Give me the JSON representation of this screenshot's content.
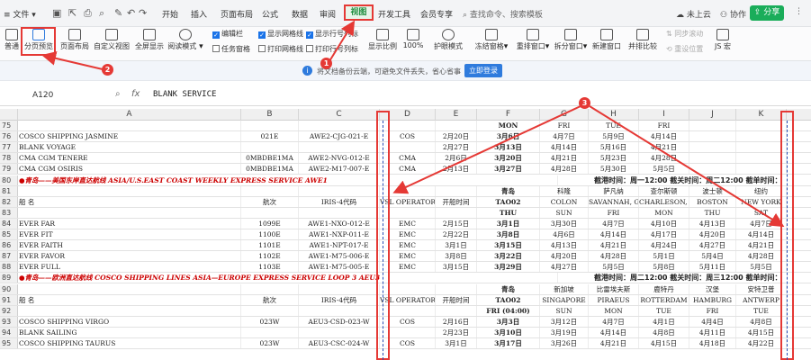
{
  "menubar": {
    "file": "文件",
    "tabs": [
      "开始",
      "插入",
      "页面布局",
      "公式",
      "数据",
      "审阅"
    ],
    "view_tab": "视图",
    "tabs_after": [
      "开发工具",
      "会员专享"
    ],
    "search": "查找命令、搜索模板",
    "cloud": "未上云",
    "collab": "协作",
    "share": "分享"
  },
  "ribbon": {
    "normal": "普通",
    "page_break": "分页预览",
    "page_layout": "页面布局",
    "custom_view": "自定义视图",
    "fullscreen": "全屏显示",
    "reading": "阅读模式",
    "chk_editbar": "编辑栏",
    "chk_taskpane": "任务窗格",
    "chk_gridlines": "显示网格线",
    "chk_print_grid": "打印网格线",
    "chk_rowcol": "显示行号列标",
    "chk_print_rowcol": "打印行号列标",
    "zoom": "显示比例",
    "zoom100": "100%",
    "eye": "护眼模式",
    "freeze": "冻结窗格",
    "rearrange": "重排窗口",
    "split": "拆分窗口",
    "new_window": "新建窗口",
    "side_by_side": "并排比较",
    "sync_scroll": "同步滚动",
    "reset_pos": "重设位置",
    "js_macro": "JS 宏"
  },
  "notice": {
    "text": "将文档备份云端，可避免文件丢失，省心省事",
    "button": "立即登录"
  },
  "formula": {
    "cell": "A120",
    "content": "BLANK  SERVICE"
  },
  "columns": [
    "A",
    "B",
    "C",
    "D",
    "E",
    "F",
    "G",
    "H",
    "I",
    "J",
    "K"
  ],
  "rows": [
    {
      "n": "75",
      "a": "",
      "b": "",
      "c": "",
      "d": "",
      "e": "",
      "f": "MON",
      "g": "FRI",
      "h": "TUE",
      "i": "FRI",
      "j": "",
      "k": ""
    },
    {
      "n": "76",
      "a": "COSCO SHIPPING JASMINE",
      "b": "021E",
      "c": "AWE2-CJG-021-E",
      "d": "COS",
      "e": "2月20日",
      "f": "3月6日",
      "g": "4月7日",
      "h": "5月9日",
      "i": "4月14日",
      "j": "",
      "k": ""
    },
    {
      "n": "77",
      "a": "BLANK VOYAGE",
      "b": "",
      "c": "",
      "d": "",
      "e": "2月27日",
      "f": "3月13日",
      "g": "4月14日",
      "h": "5月16日",
      "i": "4月21日",
      "j": "",
      "k": ""
    },
    {
      "n": "78",
      "a": "CMA CGM TENERE",
      "b": "0MBDBE1MA",
      "c": "AWE2-NVG-012-E",
      "d": "CMA",
      "e": "2月6日",
      "f": "3月20日",
      "g": "4月21日",
      "h": "5月23日",
      "i": "4月28日",
      "j": "",
      "k": ""
    },
    {
      "n": "79",
      "a": "CMA CGM OSIRIS",
      "b": "0MBDBE1MA",
      "c": "AWE2-M17-007-E",
      "d": "CMA",
      "e": "2月13日",
      "f": "3月27日",
      "g": "4月28日",
      "h": "5月30日",
      "i": "5月5日",
      "j": "",
      "k": ""
    },
    {
      "n": "80",
      "banner": "●青岛——美国东岸直达航线 ASIA/U.S.EAST COAST WEEKLY EXPRESS SERVICE AWE1",
      "right": "截港时间：周一12:00  截关时间：周二12:00  截单时间："
    },
    {
      "n": "81",
      "a": "",
      "b": "",
      "c": "",
      "d": "",
      "e": "",
      "f": "青岛",
      "g": "科隆",
      "h": "萨凡纳",
      "i": "查尔斯顿",
      "j": "波士顿",
      "k": "纽约"
    },
    {
      "n": "82",
      "a": "船         名",
      "b": "航次",
      "c": "IRIS-4代码",
      "d": "VSL OPERATOR",
      "e": "开船时间",
      "f": "TAO02",
      "g": "COLON",
      "h": "SAVANNAH, GA",
      "i": "CHARLESON, SC",
      "j": "BOSTON",
      "k": "NEW YORK"
    },
    {
      "n": "83",
      "a": "",
      "b": "",
      "c": "",
      "d": "",
      "e": "",
      "f": "THU",
      "g": "SUN",
      "h": "FRI",
      "i": "MON",
      "j": "THU",
      "k": "SAT"
    },
    {
      "n": "84",
      "a": "EVER FAR",
      "b": "1099E",
      "c": "AWE1-NXO-012-E",
      "d": "EMC",
      "e": "2月15日",
      "f": "3月1日",
      "g": "3月30日",
      "h": "4月7日",
      "i": "4月10日",
      "j": "4月13日",
      "k": "4月7日"
    },
    {
      "n": "85",
      "a": "EVER FIT",
      "b": "1100E",
      "c": "AWE1-NXP-011-E",
      "d": "EMC",
      "e": "2月22日",
      "f": "3月8日",
      "g": "4月6日",
      "h": "4月14日",
      "i": "4月17日",
      "j": "4月20日",
      "k": "4月14日"
    },
    {
      "n": "86",
      "a": "EVER FAITH",
      "b": "1101E",
      "c": "AWE1-NPT-017-E",
      "d": "EMC",
      "e": "3月1日",
      "f": "3月15日",
      "g": "4月13日",
      "h": "4月21日",
      "i": "4月24日",
      "j": "4月27日",
      "k": "4月21日"
    },
    {
      "n": "87",
      "a": "EVER FAVOR",
      "b": "1102E",
      "c": "AWE1-M75-006-E",
      "d": "EMC",
      "e": "3月8日",
      "f": "3月22日",
      "g": "4月20日",
      "h": "4月28日",
      "i": "5月1日",
      "j": "5月4日",
      "k": "4月28日"
    },
    {
      "n": "88",
      "a": "EVER FULL",
      "b": "1103E",
      "c": "AWE1-M75-005-E",
      "d": "EMC",
      "e": "3月15日",
      "f": "3月29日",
      "g": "4月27日",
      "h": "5月5日",
      "i": "5月8日",
      "j": "5月11日",
      "k": "5月5日"
    },
    {
      "n": "89",
      "banner": "●青岛——欧洲直达航线 COSCO SHIPPING LINES ASIA—EUROPE EXPRESS SERVICE LOOP 3  AEU3",
      "right": "截港时间：周二12:00  截关时间：周三12:00  截单时间："
    },
    {
      "n": "90",
      "a": "",
      "b": "",
      "c": "",
      "d": "",
      "e": "",
      "f": "青岛",
      "g": "新加坡",
      "h": "比雷埃夫斯",
      "i": "鹿特丹",
      "j": "汉堡",
      "k": "安特卫普"
    },
    {
      "n": "91",
      "a": "船         名",
      "b": "航次",
      "c": "IRIS-4代码",
      "d": "VSL OPERATOR",
      "e": "开船时间",
      "f": "TAO02",
      "g": "SINGAPORE",
      "h": "PIRAEUS",
      "i": "ROTTERDAM",
      "j": "HAMBURG",
      "k": "ANTWERP"
    },
    {
      "n": "92",
      "a": "",
      "b": "",
      "c": "",
      "d": "",
      "e": "",
      "f": "FRI (04:00)",
      "g": "SUN",
      "h": "MON",
      "i": "TUE",
      "j": "FRI",
      "k": "TUE"
    },
    {
      "n": "93",
      "a": "COSCO SHIPPING VIRGO",
      "b": "023W",
      "c": "AEU3-CSD-023-W",
      "d": "COS",
      "e": "2月16日",
      "f": "3月3日",
      "g": "3月12日",
      "h": "4月7日",
      "i": "4月1日",
      "j": "4月4日",
      "k": "4月8日"
    },
    {
      "n": "94",
      "a": "BLANK SAILING",
      "b": "",
      "c": "",
      "d": "",
      "e": "2月23日",
      "f": "3月10日",
      "g": "3月19日",
      "h": "4月14日",
      "i": "4月8日",
      "j": "4月11日",
      "k": "4月15日"
    },
    {
      "n": "95",
      "a": "COSCO SHIPPING TAURUS",
      "b": "023W",
      "c": "AEU3-CSC-024-W",
      "d": "COS",
      "e": "3月1日",
      "f": "3月17日",
      "g": "3月26日",
      "h": "4月21日",
      "i": "4月15日",
      "j": "4月18日",
      "k": "4月22日"
    }
  ],
  "badges": {
    "one": "1",
    "two": "2",
    "three": "3"
  }
}
